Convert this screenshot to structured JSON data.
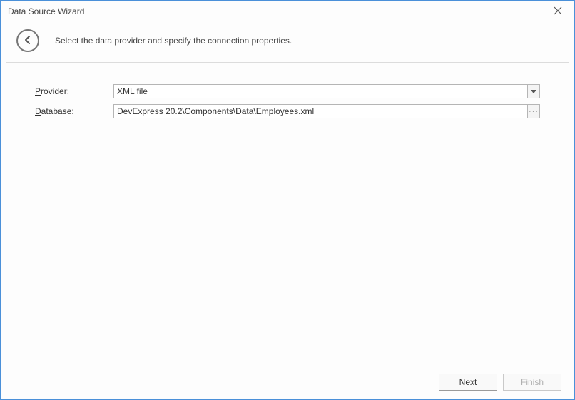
{
  "window": {
    "title": "Data Source Wizard"
  },
  "header": {
    "instruction": "Select the data provider and specify the connection properties."
  },
  "form": {
    "provider_label_pre": "P",
    "provider_label_rest": "rovider:",
    "provider_value": "XML file",
    "database_label_pre": "D",
    "database_label_rest": "atabase:",
    "database_value": "DevExpress 20.2\\Components\\Data\\Employees.xml"
  },
  "footer": {
    "next_pre": "N",
    "next_rest": "ext",
    "finish_pre": "F",
    "finish_rest": "inish"
  }
}
